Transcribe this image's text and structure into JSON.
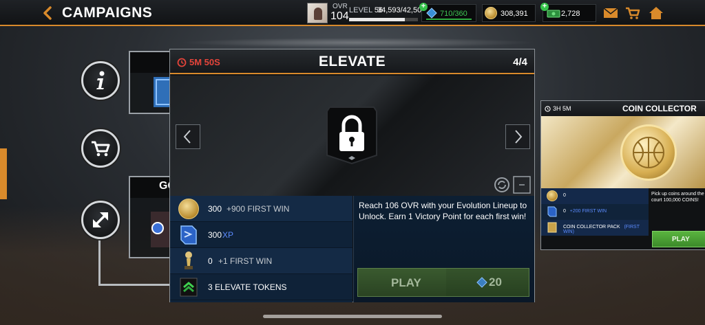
{
  "header": {
    "title": "CAMPAIGNS",
    "ovr_label": "OVR",
    "ovr_value": "104",
    "level_label": "LEVEL",
    "level_value": "56",
    "xp": "34,593/42,500",
    "xp_progress": 0.814,
    "energy": "710/360",
    "coins": "308,391",
    "cash": "2,728"
  },
  "side_buttons": [
    "info-icon",
    "cart-icon",
    "expand-icon"
  ],
  "bg_cards": {
    "second_title": "GO"
  },
  "modal": {
    "timer": "5M 50S",
    "title": "ELEVATE",
    "page": "4/4",
    "rewards": [
      {
        "icon": "coin-icon",
        "value": "300",
        "extra": "+900 FIRST WIN"
      },
      {
        "icon": "xp-icon",
        "value": "300",
        "extra_accent": "XP"
      },
      {
        "icon": "trophy-icon",
        "value": "0",
        "extra": "+1 FIRST WIN"
      },
      {
        "icon": "elevate-token-icon",
        "value": "3 ELEVATE TOKENS"
      }
    ],
    "description": "Reach 106 OVR with your Evolution Lineup to Unlock. Earn 1 Victory Point for each first win!",
    "play_label": "PLAY",
    "play_cost": "20"
  },
  "right_card": {
    "timer": "3H 5M",
    "title": "COIN COLLECTOR",
    "rows": [
      {
        "value": "0"
      },
      {
        "value": "0",
        "accent": "+200 FIRST WIN"
      },
      {
        "value": "COIN COLLECTOR PACK",
        "accent": "(FIRST WIN)"
      }
    ],
    "description": "Pick up coins around the court 100,000 COINS!",
    "play_label": "PLAY"
  },
  "colors": {
    "accent": "#d98a2b",
    "timer_red": "#e5443a",
    "xp_blue": "#5c8cff",
    "energy_green": "#2fae40"
  }
}
